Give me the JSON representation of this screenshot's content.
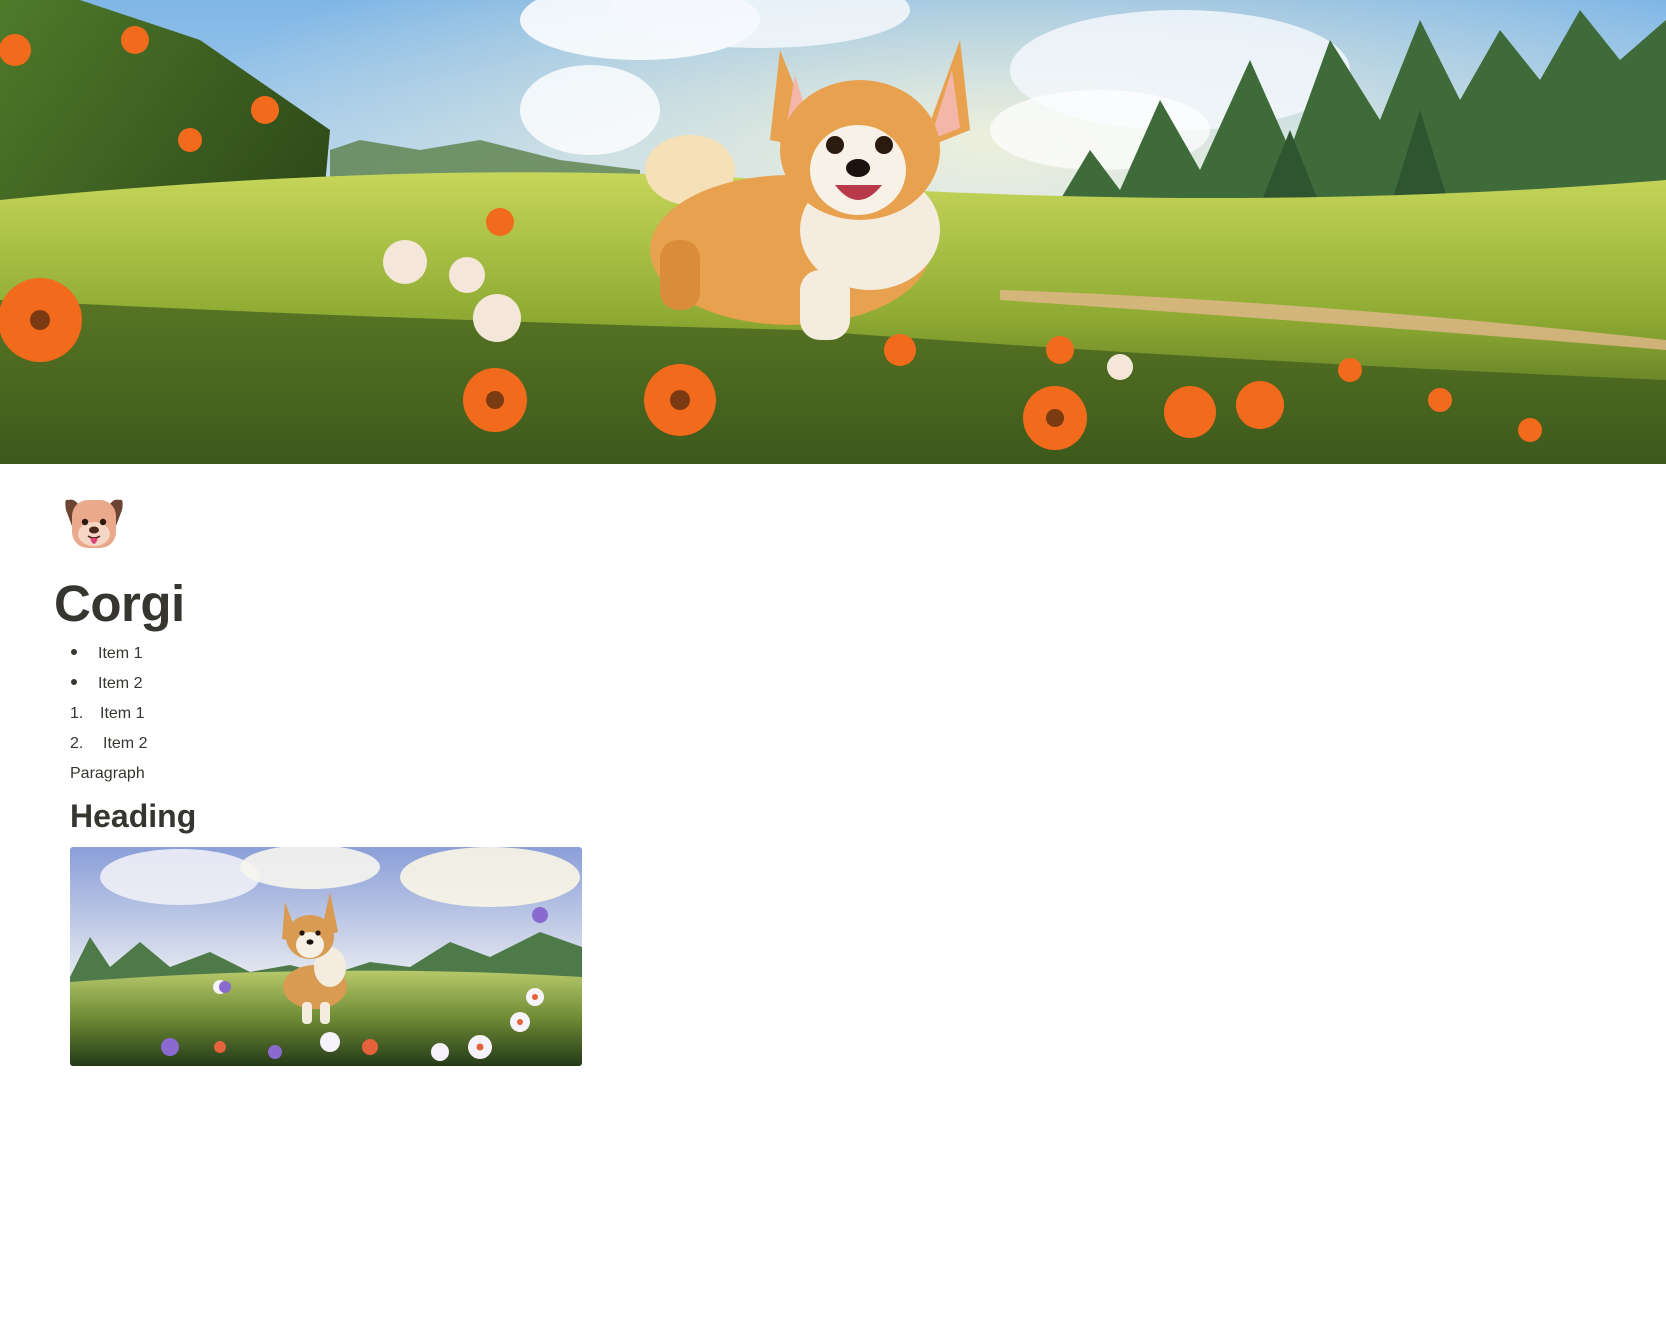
{
  "cover": {
    "icon": "corgi-meadow-cover-image"
  },
  "page_icon": {
    "icon": "dog-face-icon"
  },
  "title": "Corgi",
  "bulleted_list": [
    {
      "label": "Item 1"
    },
    {
      "label": "Item 2"
    }
  ],
  "numbered_list": [
    {
      "marker": "1.",
      "label": "Item 1"
    },
    {
      "marker": "2.",
      "label": "Item 2"
    }
  ],
  "paragraph": "Paragraph",
  "heading": "Heading",
  "image": {
    "icon": "corgi-field-image"
  },
  "colors": {
    "text": "#37352f",
    "background": "#ffffff",
    "meadow_green": "#8fb83a",
    "sky_blue": "#8fc0e8",
    "flower_orange": "#f26a1b",
    "corgi_fur": "#e8a14e"
  }
}
